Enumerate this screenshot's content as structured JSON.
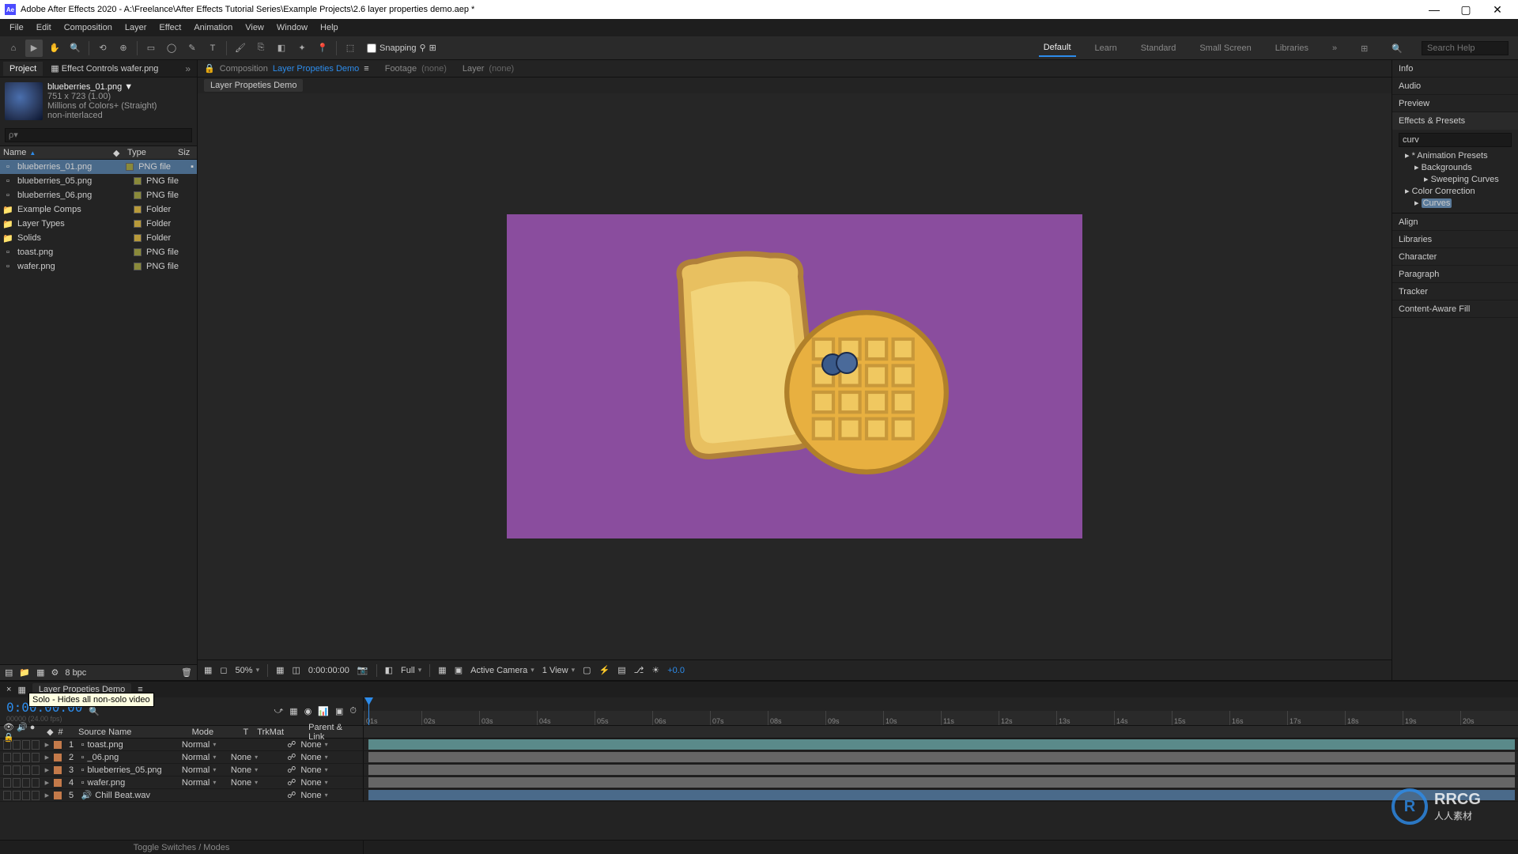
{
  "titlebar": {
    "app": "Ae",
    "title": "Adobe After Effects 2020 - A:\\Freelance\\After Effects Tutorial Series\\Example Projects\\2.6 layer properties demo.aep *"
  },
  "menu": [
    "File",
    "Edit",
    "Composition",
    "Layer",
    "Effect",
    "Animation",
    "View",
    "Window",
    "Help"
  ],
  "toolbar": {
    "snapping": "Snapping"
  },
  "workspaces": {
    "items": [
      "Default",
      "Learn",
      "Standard",
      "Small Screen",
      "Libraries"
    ],
    "search_placeholder": "Search Help"
  },
  "project_panel": {
    "tabs": {
      "project": "Project",
      "effect_controls": "Effect Controls wafer.png"
    },
    "selected_item": {
      "name": "blueberries_01.png ▼",
      "dims": "751 x 723 (1.00)",
      "color": "Millions of Colors+ (Straight)",
      "interlace": "non-interlaced"
    },
    "search_placeholder": "ρ▾",
    "columns": {
      "name": "Name",
      "type": "Type",
      "size": "Siz"
    },
    "rows": [
      {
        "icon": "img",
        "name": "blueberries_01.png",
        "label": "#8a8a3a",
        "type": "PNG file",
        "sel": true,
        "used": true
      },
      {
        "icon": "img",
        "name": "blueberries_05.png",
        "label": "#8a8a3a",
        "type": "PNG file"
      },
      {
        "icon": "img",
        "name": "blueberries_06.png",
        "label": "#8a8a3a",
        "type": "PNG file"
      },
      {
        "icon": "folder",
        "name": "Example Comps",
        "label": "#b89a3a",
        "type": "Folder"
      },
      {
        "icon": "folder",
        "name": "Layer Types",
        "label": "#b89a3a",
        "type": "Folder"
      },
      {
        "icon": "folder",
        "name": "Solids",
        "label": "#b89a3a",
        "type": "Folder"
      },
      {
        "icon": "img",
        "name": "toast.png",
        "label": "#8a8a3a",
        "type": "PNG file"
      },
      {
        "icon": "img",
        "name": "wafer.png",
        "label": "#8a8a3a",
        "type": "PNG file"
      }
    ],
    "footer_bpc": "8 bpc"
  },
  "comp_panel": {
    "comp_label": "Composition",
    "comp_name": "Layer Propeties Demo",
    "footage_label": "Footage",
    "footage_val": "(none)",
    "layer_label": "Layer",
    "layer_val": "(none)",
    "breadcrumb": "Layer Propeties Demo"
  },
  "viewer_footer": {
    "zoom": "50%",
    "timecode": "0:00:00:00",
    "res": "Full",
    "camera": "Active Camera",
    "views": "1 View",
    "exposure": "+0.0"
  },
  "right_panels": {
    "collapsed": [
      "Info",
      "Audio",
      "Preview"
    ],
    "effects_title": "Effects & Presets",
    "effects_search": "curv",
    "tree": [
      {
        "lvl": 1,
        "text": "* Animation Presets"
      },
      {
        "lvl": 2,
        "text": "Backgrounds"
      },
      {
        "lvl": 3,
        "text": "Sweeping Curves"
      },
      {
        "lvl": 1,
        "text": "Color Correction"
      },
      {
        "lvl": 2,
        "text": "Curves",
        "hit": true
      }
    ],
    "lower": [
      "Align",
      "Libraries",
      "Character",
      "Paragraph",
      "Tracker",
      "Content-Aware Fill"
    ]
  },
  "timeline": {
    "tab": "Layer Propeties Demo",
    "timecode": "0:00:00:00",
    "fps": "00000 (24.00 fps)",
    "ruler": [
      "01s",
      "02s",
      "03s",
      "04s",
      "05s",
      "06s",
      "07s",
      "08s",
      "09s",
      "10s",
      "11s",
      "12s",
      "13s",
      "14s",
      "15s",
      "16s",
      "17s",
      "18s",
      "19s",
      "20s"
    ],
    "cols": {
      "src": "Source Name",
      "mode": "Mode",
      "t": "T",
      "tm": "TrkMat",
      "par": "Parent & Link"
    },
    "layers": [
      {
        "num": "1",
        "label": "#c47a4a",
        "name": "toast.png",
        "mode": "Normal",
        "tm": "",
        "par": "None",
        "bar": "aqua",
        "hidden_overlay": true
      },
      {
        "num": "2",
        "label": "#c47a4a",
        "name": "_06.png",
        "mode": "Normal",
        "tm": "None",
        "par": "None",
        "bar": "norm"
      },
      {
        "num": "3",
        "label": "#c47a4a",
        "name": "blueberries_05.png",
        "mode": "Normal",
        "tm": "None",
        "par": "None",
        "bar": "norm"
      },
      {
        "num": "4",
        "label": "#c47a4a",
        "name": "wafer.png",
        "mode": "Normal",
        "tm": "None",
        "par": "None",
        "bar": "norm"
      },
      {
        "num": "5",
        "label": "#c47a4a",
        "name": "Chill Beat.wav",
        "mode": "",
        "tm": "",
        "par": "None",
        "bar": "wav",
        "audio": true
      }
    ],
    "tooltip": "Solo - Hides all non-solo video",
    "toggle": "Toggle Switches / Modes"
  },
  "watermark": {
    "logo": "R",
    "brand": "RRCG",
    "sub": "人人素材"
  }
}
